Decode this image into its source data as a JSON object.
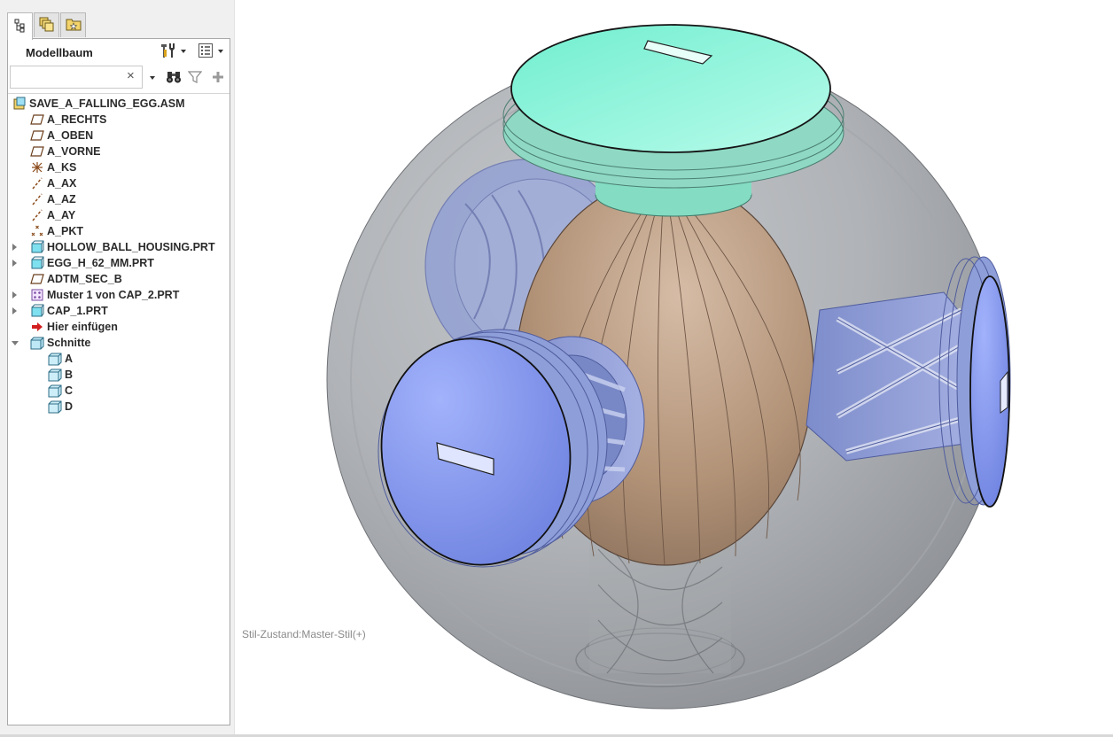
{
  "tabs": [
    {
      "name": "model-tree-icon"
    },
    {
      "name": "layers-icon"
    },
    {
      "name": "favorites-folder-icon"
    }
  ],
  "panel": {
    "title": "Modellbaum",
    "settings_icon": "tools-icon",
    "show_icon": "tree-columns-icon"
  },
  "search": {
    "value": "",
    "placeholder": "",
    "clear_glyph": "×",
    "find_icon": "binoculars-icon",
    "filter_icon": "filter-icon",
    "add_icon": "plus-icon"
  },
  "tree": {
    "items": [
      {
        "label": "SAVE_A_FALLING_EGG.ASM",
        "icon": "assembly-icon",
        "level": 0,
        "expander": "none"
      },
      {
        "label": "A_RECHTS",
        "icon": "datum-plane-icon",
        "level": 1,
        "expander": "none"
      },
      {
        "label": "A_OBEN",
        "icon": "datum-plane-icon",
        "level": 1,
        "expander": "none"
      },
      {
        "label": "A_VORNE",
        "icon": "datum-plane-icon",
        "level": 1,
        "expander": "none"
      },
      {
        "label": "A_KS",
        "icon": "coordinate-system-icon",
        "level": 1,
        "expander": "none"
      },
      {
        "label": "A_AX",
        "icon": "datum-axis-icon",
        "level": 1,
        "expander": "none"
      },
      {
        "label": "A_AZ",
        "icon": "datum-axis-icon",
        "level": 1,
        "expander": "none"
      },
      {
        "label": "A_AY",
        "icon": "datum-axis-icon",
        "level": 1,
        "expander": "none"
      },
      {
        "label": "A_PKT",
        "icon": "datum-point-icon",
        "level": 1,
        "expander": "none"
      },
      {
        "label": "HOLLOW_BALL_HOUSING.PRT",
        "icon": "part-icon",
        "level": 1,
        "expander": "collapsed"
      },
      {
        "label": "EGG_H_62_MM.PRT",
        "icon": "part-icon",
        "level": 1,
        "expander": "collapsed"
      },
      {
        "label": "ADTM_SEC_B",
        "icon": "datum-plane-icon",
        "level": 1,
        "expander": "none"
      },
      {
        "label": "Muster 1 von CAP_2.PRT",
        "icon": "pattern-icon",
        "level": 1,
        "expander": "collapsed"
      },
      {
        "label": "CAP_1.PRT",
        "icon": "part-icon",
        "level": 1,
        "expander": "collapsed"
      },
      {
        "label": "Hier einfügen",
        "icon": "insert-here-arrow-icon",
        "level": 1,
        "expander": "none"
      },
      {
        "label": "Schnitte",
        "icon": "sections-folder-icon",
        "level": 1,
        "expander": "expanded"
      },
      {
        "label": "A",
        "icon": "section-icon",
        "level": 2,
        "expander": "none"
      },
      {
        "label": "B",
        "icon": "section-icon",
        "level": 2,
        "expander": "none"
      },
      {
        "label": "C",
        "icon": "section-icon",
        "level": 2,
        "expander": "none"
      },
      {
        "label": "D",
        "icon": "section-icon",
        "level": 2,
        "expander": "none"
      }
    ]
  },
  "viewport": {
    "status_text": "Stil-Zustand:Master-Stil(+)"
  },
  "colors": {
    "housing": "#b4b7bb",
    "egg": "#b89a82",
    "top_cap": "#7ff2d6",
    "side_cap": "#7f92ee",
    "holder": "#8d9bd2"
  }
}
